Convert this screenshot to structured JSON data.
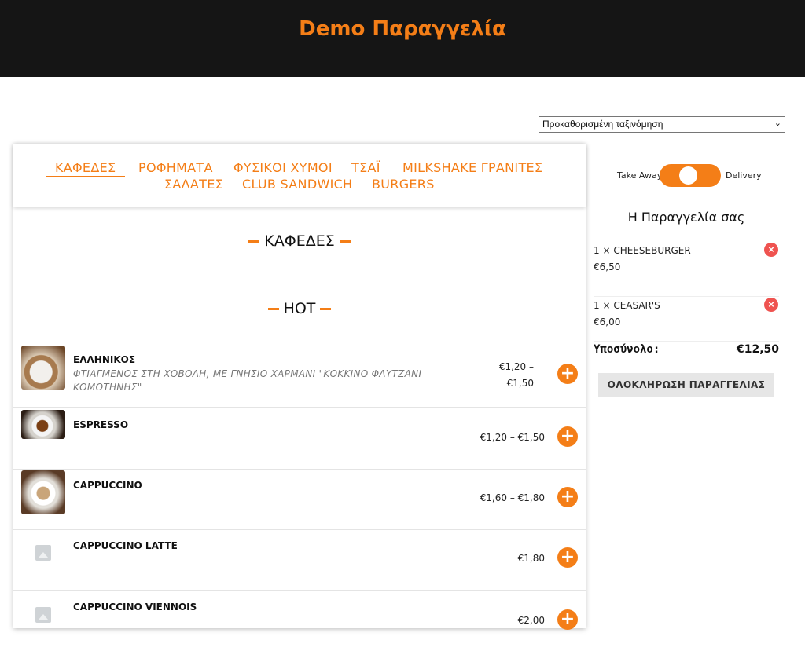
{
  "header": {
    "title": "Demo Παραγγελία"
  },
  "sort": {
    "selected": "Προκαθορισμένη ταξινόμηση"
  },
  "categories": {
    "row1": [
      "ΚΑΦΕΔΕΣ",
      "ΡΟΦΗΜΑΤΑ",
      "ΦΥΣΙΚΟΙ ΧΥΜΟΙ",
      "ΤΣΑΪ",
      "MILKSHAKE ΓΡΑΝΙΤΕΣ"
    ],
    "row2": [
      "ΣΑΛΑΤΕΣ",
      "CLUB SANDWICH",
      "BURGERS"
    ],
    "active": "ΚΑΦΕΔΕΣ"
  },
  "sections": {
    "category_title": "ΚΑΦΕΔΕΣ",
    "subcategory_title": "HOT"
  },
  "products": [
    {
      "name": "ΕΛΛΗΝΙΚΟΣ",
      "description": "ΦΤΙΑΓΜΕΝΟΣ ΣΤΗ ΧΟΒΟΛΗ, ΜΕ ΓΝΗΣΙΟ ΧΑΡΜΑΝΙ \"ΚΟΚΚΙΝΟ ΦΛΥΤΖΑΝΙ ΚΟΜΟΤΗΝΗΣ\"",
      "price_line1": "€1,20 –",
      "price_line2": "€1,50",
      "image": "greek-coffee-image"
    },
    {
      "name": "ESPRESSO",
      "description": "",
      "price_line1": "€1,20 – €1,50",
      "price_line2": "",
      "image": "espresso-image"
    },
    {
      "name": "CAPPUCCINO",
      "description": "",
      "price_line1": "€1,60 – €1,80",
      "price_line2": "",
      "image": "cappuccino-image"
    },
    {
      "name": "CAPPUCCINO LATTE",
      "description": "",
      "price_line1": "€1,80",
      "price_line2": "",
      "image": "placeholder-icon"
    },
    {
      "name": "CAPPUCCINO VIENNOIS",
      "description": "",
      "price_line1": "€2,00",
      "price_line2": "",
      "image": "placeholder-icon"
    }
  ],
  "add_icon": "plus-circle-icon",
  "delivery_toggle": {
    "left_label": "Take Away",
    "right_label": "Delivery",
    "accent": "#f47e17"
  },
  "order": {
    "title": "Η Παραγγελία σας",
    "items": [
      {
        "label": "1 × CHEESEBURGER",
        "price": "€6,50"
      },
      {
        "label": "1 × CEASAR'S",
        "price": "€6,00"
      }
    ],
    "subtotal_label": "Υποσύνολο:",
    "subtotal_value": "€12,50",
    "checkout_label": "ΟΛΟΚΛΗΡΩΣΗ ΠΑΡΑΓΓΕΛΙΑΣ",
    "remove_icon": "close-circle-icon"
  },
  "colors": {
    "accent": "#f47e17",
    "header_bg": "#151515",
    "remove": "#ef5350"
  }
}
